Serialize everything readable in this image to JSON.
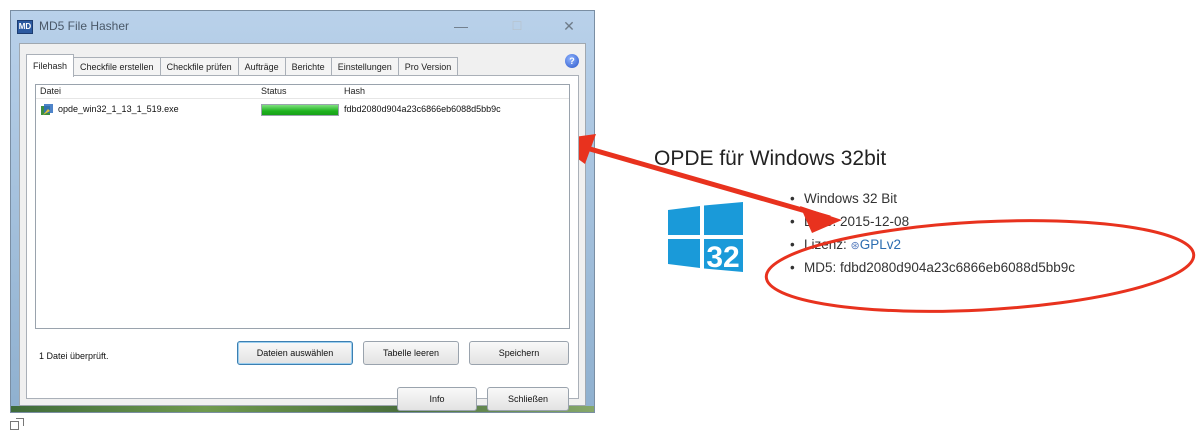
{
  "window": {
    "title": "MD5 File Hasher",
    "app_icon_text": "MD",
    "controls": {
      "minimize": "—",
      "maximize": "☐",
      "close": "✕"
    },
    "tabs": [
      {
        "label": "Filehash",
        "active": true
      },
      {
        "label": "Checkfile erstellen",
        "active": false
      },
      {
        "label": "Checkfile prüfen",
        "active": false
      },
      {
        "label": "Aufträge",
        "active": false
      },
      {
        "label": "Berichte",
        "active": false
      },
      {
        "label": "Einstellungen",
        "active": false
      },
      {
        "label": "Pro Version",
        "active": false
      }
    ],
    "help_label": "?",
    "list": {
      "columns": [
        "Datei",
        "Status",
        "Hash"
      ],
      "rows": [
        {
          "file": "opde_win32_1_13_1_519.exe",
          "progress": 1.0,
          "hash": "fdbd2080d904a23c6866eb6088d5bb9c"
        }
      ]
    },
    "status_text": "1 Datei überprüft.",
    "buttons": {
      "select_files": "Dateien auswählen",
      "clear_table": "Tabelle leeren",
      "save": "Speichern",
      "info": "Info",
      "close": "Schließen"
    }
  },
  "page": {
    "heading": "OPDE für Windows 32bit",
    "logo_text": "32",
    "bullets": {
      "platform": "Windows 32 Bit",
      "date": "Date: 2015-12-08",
      "license_prefix": "Lizenz: ",
      "license_link": "GPLv2",
      "md5": "MD5: fdbd2080d904a23c6866eb6088d5bb9c"
    }
  },
  "colors": {
    "annotation": "#e8321e",
    "windows_logo": "#1a9ad9",
    "progress": "#1fb31f",
    "link": "#2b6cb0"
  },
  "icons": {
    "window_app": "app-icon",
    "file": "exe-file-icon",
    "license": "gnu-icon",
    "resize": "enlarge-icon"
  }
}
